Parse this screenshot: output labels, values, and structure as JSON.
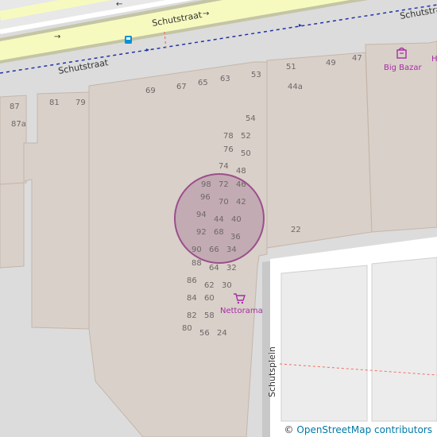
{
  "streets": {
    "schutstraat_main": "Schutstraat",
    "schutstraat_lower": "Schutstraat",
    "schutstraat_right": "Schutstraat",
    "schutsplein": "Schutsplein"
  },
  "pois": {
    "big_bazar": "Big Bazar",
    "nettorama": "Nettorama",
    "partial_label": "H"
  },
  "house_numbers": {
    "n87": "87",
    "n87a": "87a",
    "n81": "81",
    "n79": "79",
    "n69": "69",
    "n67": "67",
    "n65": "65",
    "n63": "63",
    "n53": "53",
    "n51": "51",
    "n49": "49",
    "n47": "47",
    "n44a": "44a",
    "n54": "54",
    "n78": "78",
    "n52": "52",
    "n76": "76",
    "n50": "50",
    "n74": "74",
    "n48": "48",
    "n98": "98",
    "n72": "72",
    "n46": "46",
    "n96": "96",
    "n70": "70",
    "n42": "42",
    "n94": "94",
    "n44": "44",
    "n40": "40",
    "n92": "92",
    "n68": "68",
    "n36": "36",
    "n90": "90",
    "n66": "66",
    "n34": "34",
    "n22": "22",
    "n88": "88",
    "n64": "64",
    "n32": "32",
    "n86": "86",
    "n62": "62",
    "n30": "30",
    "n84": "84",
    "n60": "60",
    "n82": "82",
    "n58": "58",
    "n80": "80",
    "n56": "56",
    "n24": "24"
  },
  "attribution": {
    "copyright": "©",
    "link": "OpenStreetMap contributors"
  },
  "colors": {
    "building": "#d9d0c9",
    "building_outline": "#c4b6ab",
    "road_primary": "#f7fabf",
    "road_casing": "#a7a988",
    "highlight_circle": "#b08ca3",
    "poi": "#a62ea6",
    "bus_stop": "#0092da",
    "route": "#0000aa"
  },
  "icons": {
    "shop": "shopping-cart-icon",
    "dept_store": "department-store-icon",
    "bus": "bus-stop-icon"
  }
}
